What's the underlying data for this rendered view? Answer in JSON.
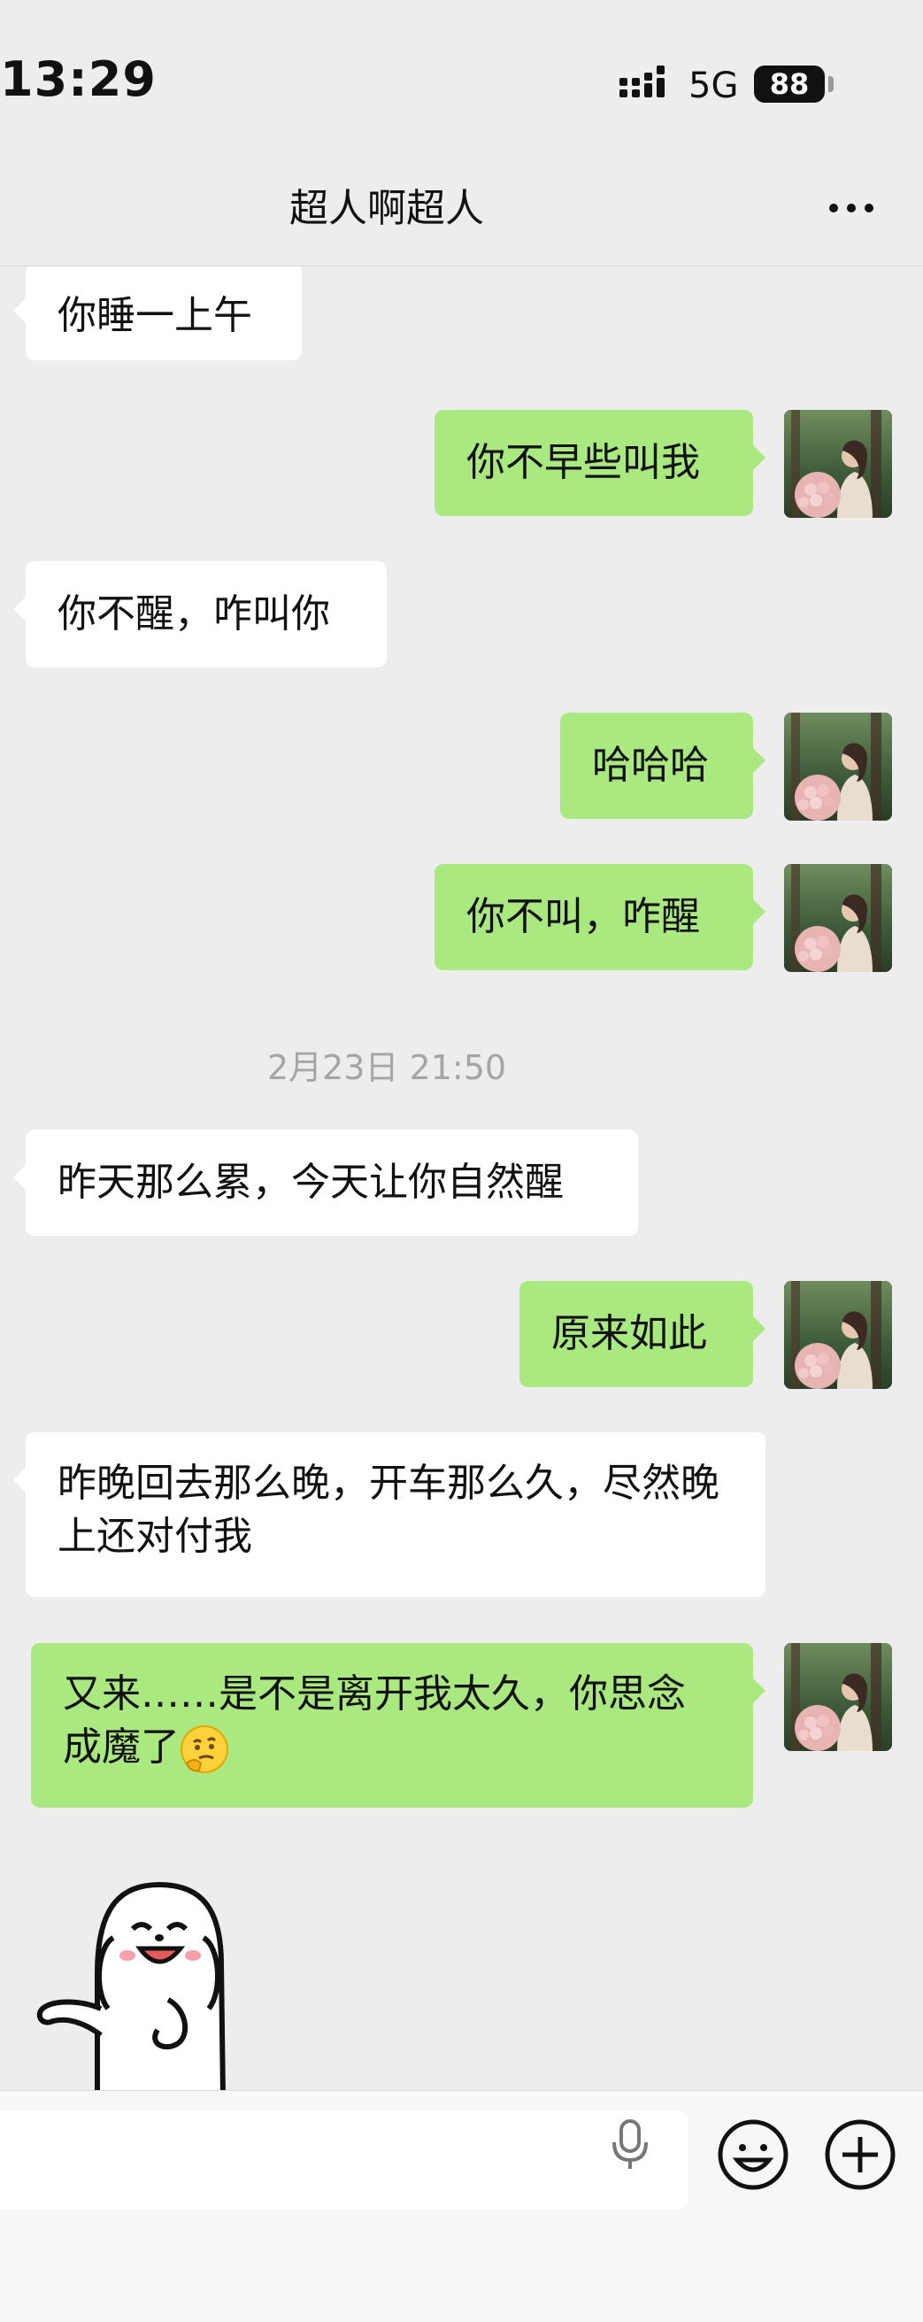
{
  "status_bar": {
    "time": "13:29",
    "network": "5G",
    "battery": "88"
  },
  "header": {
    "title": "超人啊超人"
  },
  "messages": [
    {
      "from": "them",
      "text": "你睡一上午"
    },
    {
      "from": "me",
      "text": "你不早些叫我"
    },
    {
      "from": "them",
      "text": "你不醒，咋叫你"
    },
    {
      "from": "me",
      "text": "哈哈哈"
    },
    {
      "from": "me",
      "text": "你不叫，咋醒"
    },
    {
      "type": "time",
      "text": "2月23日 21:50"
    },
    {
      "from": "them",
      "text": "昨天那么累，今天让你自然醒"
    },
    {
      "from": "me",
      "text": "原来如此"
    },
    {
      "from": "them",
      "text": "昨晚回去那么晚，开车那么久，尽然晚上还对付我"
    },
    {
      "from": "me",
      "text": "又来……是不是离开我太久，你思念成魔了",
      "emoji": "thinking-face"
    },
    {
      "from": "them",
      "type": "sticker",
      "sticker": "cartoon-dog-waving"
    }
  ],
  "colors": {
    "outgoing": "#a9e97f",
    "incoming": "#ffffff",
    "background": "#ededed"
  },
  "icons": [
    "signal-icon",
    "more-icon",
    "mic-icon",
    "emoji-icon",
    "plus-icon"
  ]
}
